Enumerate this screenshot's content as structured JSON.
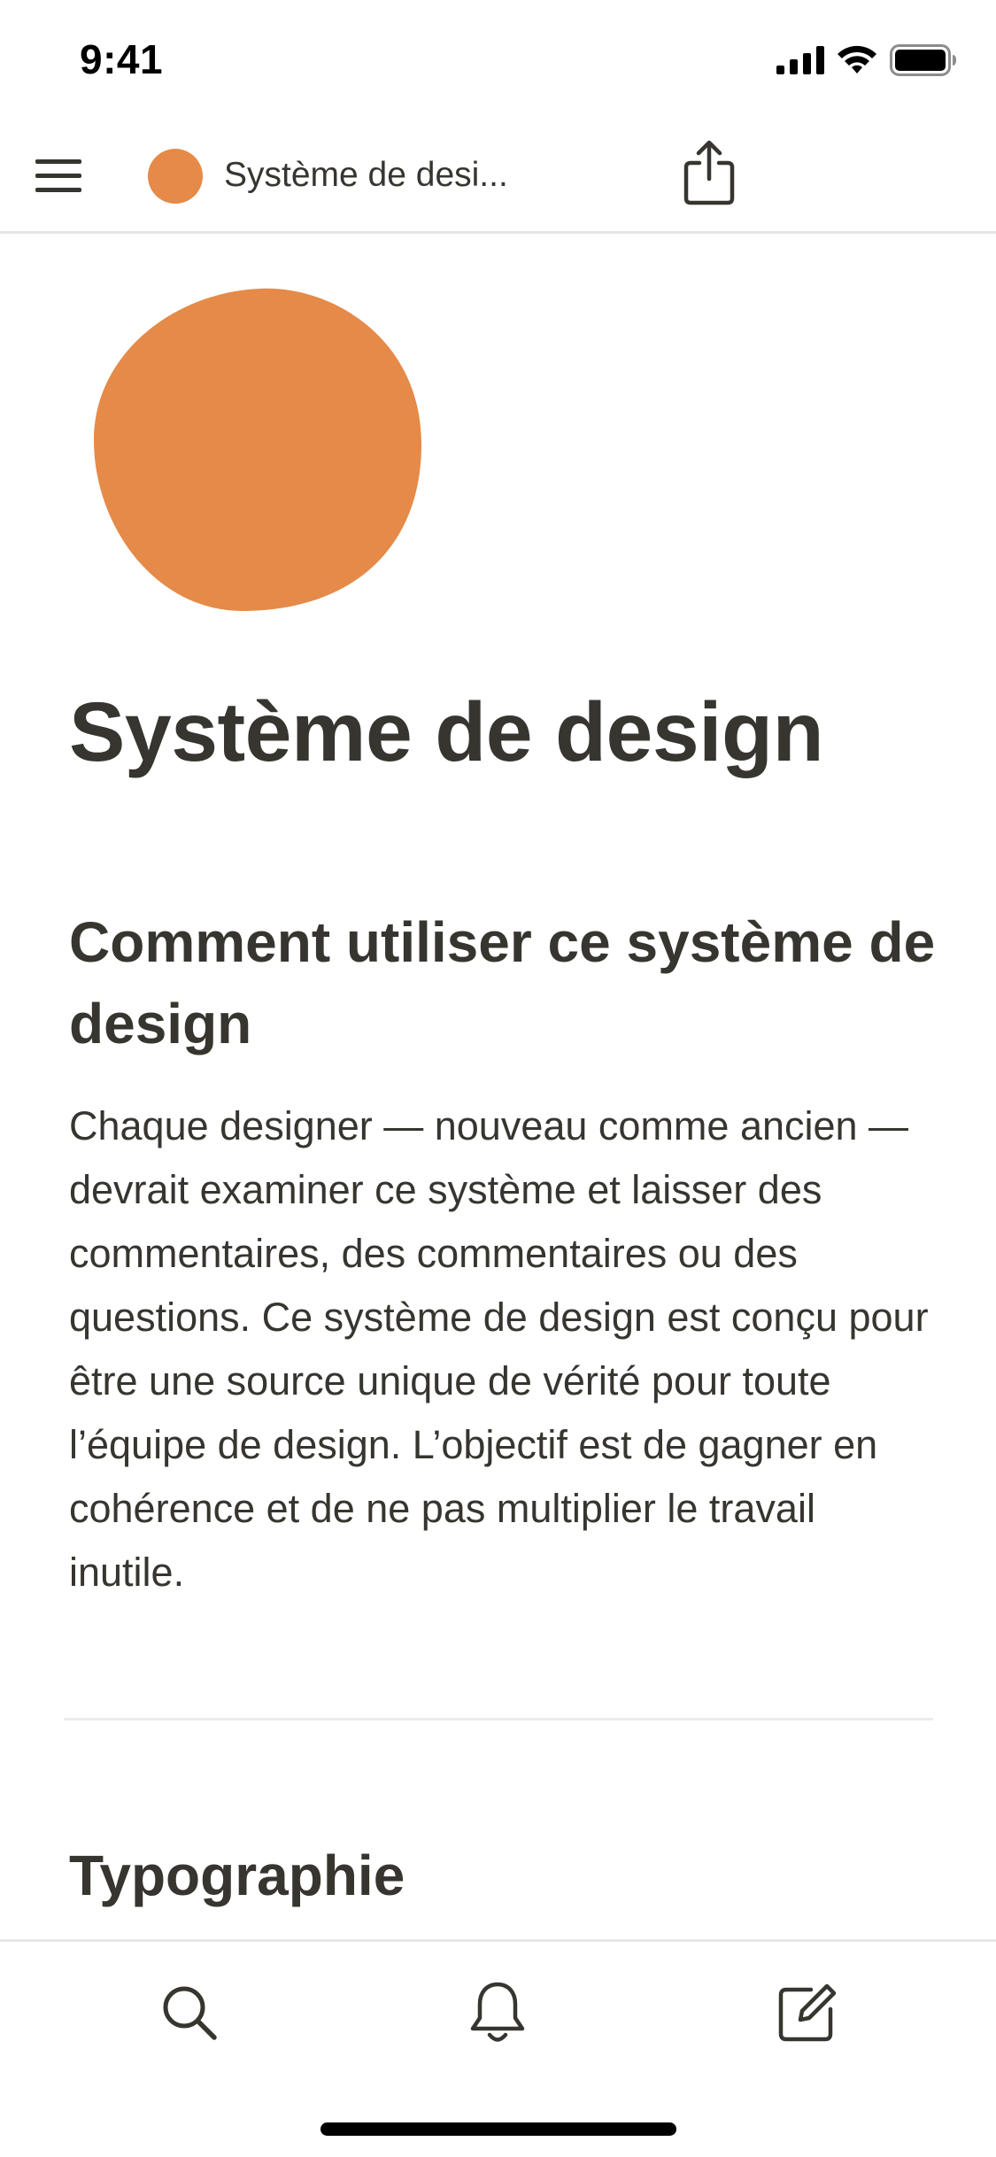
{
  "status_bar": {
    "time": "9:41"
  },
  "nav": {
    "title": "Système de desi...",
    "menu_icon": "hamburger-menu-icon",
    "share_icon": "share-icon",
    "page_icon_color": "#e58a48"
  },
  "page": {
    "icon_color": "#e58a48",
    "title": "Système de design",
    "section": {
      "heading": "Comment utiliser ce système de design",
      "body": "Chaque designer — nouveau comme ancien — devrait examiner ce système et laisser des commentaires, des commentaires ou des questions. Ce système de design est conçu pour être une source unique de vérité pour toute l’équipe de design. L’objectif est de gagner en cohérence et de ne pas multiplier le travail inutile."
    },
    "next_heading": "Typographie"
  },
  "bottom_bar": {
    "items": [
      {
        "icon": "search-icon"
      },
      {
        "icon": "bell-icon"
      },
      {
        "icon": "compose-icon"
      }
    ]
  },
  "colors": {
    "text": "#37352f",
    "accent": "#e58a48",
    "divider": "#ebebea"
  }
}
